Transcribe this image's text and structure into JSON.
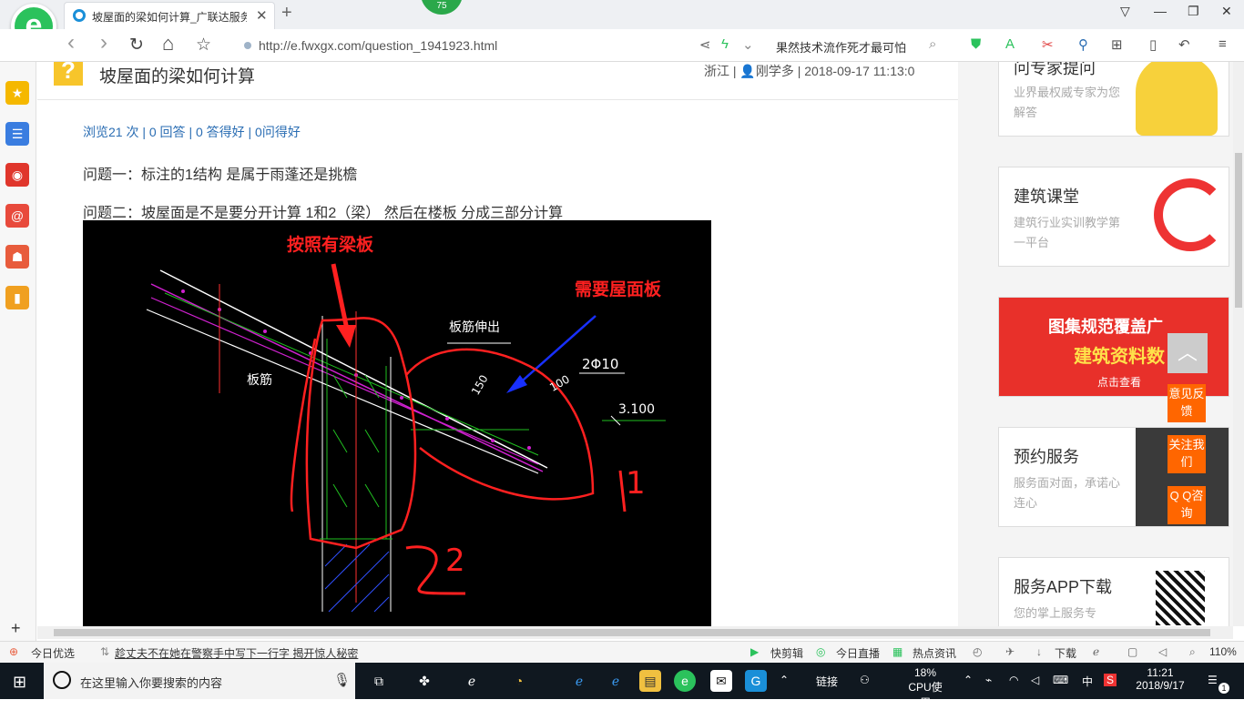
{
  "browser": {
    "logo_letter": "e",
    "tab_title": "坡屋面的梁如何计算_广联达服务",
    "new_tab": "+",
    "badge": "75",
    "win_restore": "▽",
    "win_min": "—",
    "win_max": "❐",
    "win_close": "✕",
    "back": "‹",
    "forward": "›",
    "refresh": "↻",
    "home": "⌂",
    "star": "☆",
    "url": "http://e.fwxgx.com/question_1941923.html",
    "news_ticker": "果然技术流作死才最可怕",
    "accent": "#2bc25c"
  },
  "sidebar": {
    "items": [
      {
        "name": "favorites",
        "glyph": "★",
        "color": "#f5b800"
      },
      {
        "name": "news",
        "glyph": "☰",
        "color": "#3a7de0"
      },
      {
        "name": "weibo",
        "glyph": "◉",
        "color": "#e0362c"
      },
      {
        "name": "mail",
        "glyph": "@",
        "color": "#e84a3c"
      },
      {
        "name": "game",
        "glyph": "☗",
        "color": "#e85c3c"
      },
      {
        "name": "notes",
        "glyph": "▮",
        "color": "#f0a020"
      }
    ],
    "add": "+"
  },
  "question": {
    "mark": "?",
    "title": "坡屋面的梁如何计算",
    "meta": "浙江 | 👤刚学多 | 2018-09-17 11:13:0",
    "stats": "浏览21 次 | 0 回答 | 0 答得好 | 0问得好",
    "line1": "问题一：标注的1结构  是属于雨蓬还是挑檐",
    "line2": "问题二：坡屋面是不是要分开计算  1和2（梁）  然后在楼板  分成三部分计算"
  },
  "drawing": {
    "label_beam_slab": "按照有梁板",
    "label_roof_slab": "需要屋面板",
    "label_rebar_out": "板筋伸出",
    "label_rebar": "板筋",
    "label_2phi10": "2Φ10",
    "label_100": "100",
    "label_150": "150",
    "label_elev": "3.100",
    "label_1": "1",
    "label_2": "2"
  },
  "right": {
    "card1_title": "问专家提问",
    "card1_sub": "业界最权威专家为您解答",
    "card2_title": "建筑课堂",
    "card2_sub": "建筑行业实训教学第一平台",
    "banner_line1": "图集规范覆盖广",
    "banner_line2": "建筑资料数",
    "banner_btn": "点击查看",
    "card4_title": "预约服务",
    "card4_sub": "服务面对面，承诺心连心",
    "card5_title": "服务APP下载",
    "card5_sub": "您的掌上服务专",
    "float_top": "︿",
    "float_feedback": "意见反馈",
    "float_follow": "关注我们",
    "float_qq": "Q Q咨询"
  },
  "statusbar": {
    "today_pick": "今日优选",
    "headline": "趁丈夫不在她在警察手中写下一行字 揭开惊人秘密",
    "clip": "快剪辑",
    "live": "今日直播",
    "hot": "热点资讯",
    "download": "下载",
    "zoom": "110%"
  },
  "taskbar": {
    "search_placeholder": "在这里输入你要搜索的内容",
    "link": "链接",
    "cpu_pct": "18%",
    "cpu_label": "CPU使用",
    "ime": "中",
    "time": "11:21",
    "date": "2018/9/17",
    "notif": "1"
  }
}
